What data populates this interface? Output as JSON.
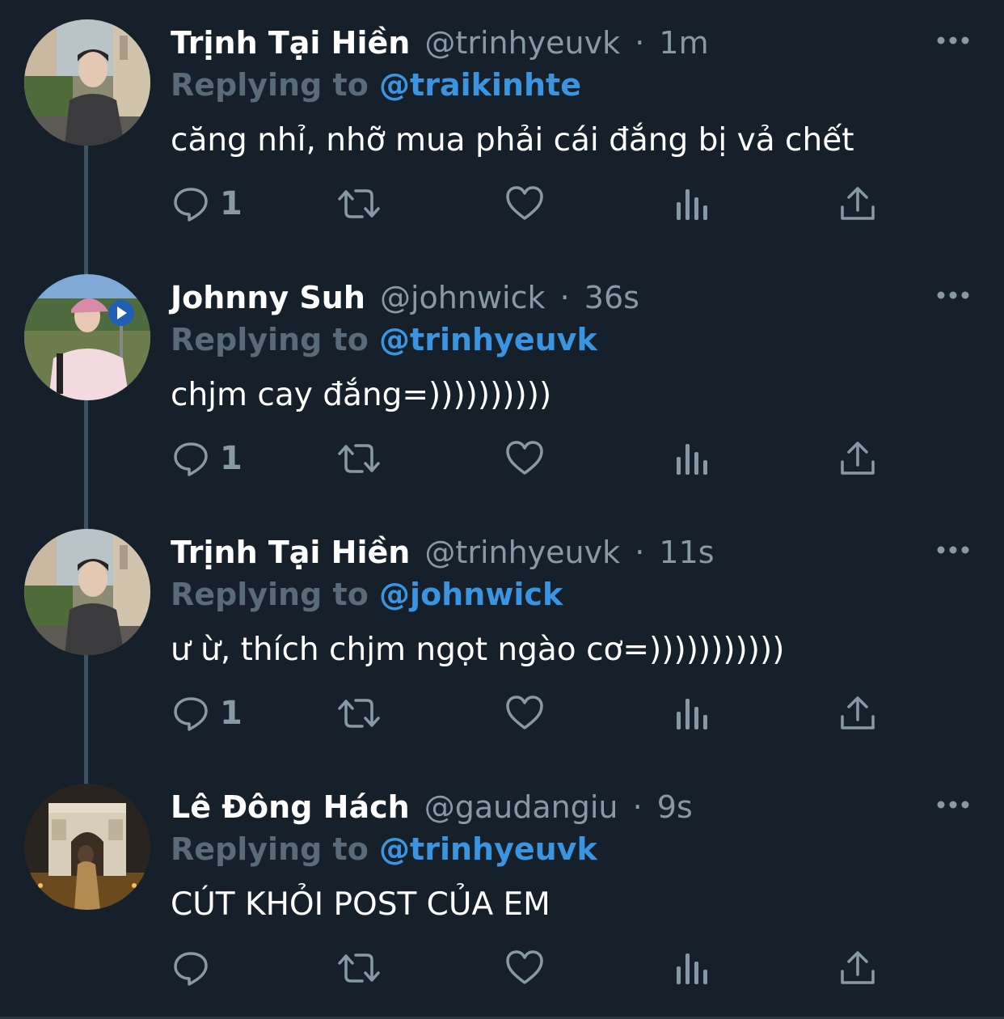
{
  "tweets": [
    {
      "name": "Trịnh Tại Hiền",
      "handle": "@trinhyeuvk",
      "separator": "·",
      "time": "1m",
      "replying_label": "Replying to",
      "replying_to": "@traikinhte",
      "text": "căng nhỉ, nhỡ mua phải cái đắng bị vả chết",
      "reply_count": "1",
      "avatar": "person-on-street-photo"
    },
    {
      "name": "Johnny Suh",
      "handle": "@johnwick",
      "separator": "·",
      "time": "36s",
      "replying_label": "Replying to",
      "replying_to": "@trinhyeuvk",
      "text": "chjm cay đắng=))))))))))",
      "reply_count": "1",
      "avatar": "person-pink-cap-photo"
    },
    {
      "name": "Trịnh Tại Hiền",
      "handle": "@trinhyeuvk",
      "separator": "·",
      "time": "11s",
      "replying_label": "Replying to",
      "replying_to": "@johnwick",
      "text": "ư ừ, thích chjm ngọt ngào cơ=)))))))))))",
      "reply_count": "1",
      "avatar": "person-on-street-photo"
    },
    {
      "name": "Lê Đông Hách",
      "handle": "@gaudangiu",
      "separator": "·",
      "time": "9s",
      "replying_label": "Replying to",
      "replying_to": "@trinhyeuvk",
      "text": "CÚT KHỎI POST CỦA EM",
      "reply_count": "",
      "avatar": "arc-de-triomphe-night-photo"
    }
  ],
  "icons": {
    "reply": "reply-icon",
    "retweet": "retweet-icon",
    "like": "heart-icon",
    "analytics": "analytics-icon",
    "share": "share-icon",
    "more": "more-icon"
  },
  "colors": {
    "background": "#15202b",
    "name": "#ffffff",
    "meta": "#8899a6",
    "replying_label": "#596a78",
    "mention": "#3b94e0",
    "icon": "#8899a6",
    "thread_line": "#3d5466"
  }
}
